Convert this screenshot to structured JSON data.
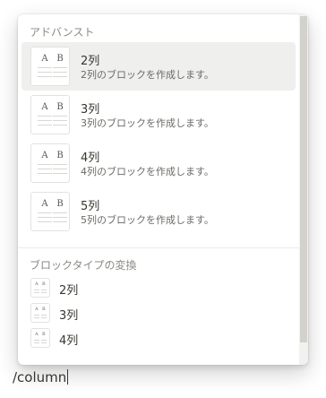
{
  "menu": {
    "section1_label": "アドバンスト",
    "items": [
      {
        "title": "2列",
        "desc": "2列のブロックを作成します。",
        "selected": true,
        "icon": "columns-preview-icon"
      },
      {
        "title": "3列",
        "desc": "3列のブロックを作成します。",
        "selected": false,
        "icon": "columns-preview-icon"
      },
      {
        "title": "4列",
        "desc": "4列のブロックを作成します。",
        "selected": false,
        "icon": "columns-preview-icon"
      },
      {
        "title": "5列",
        "desc": "5列のブロックを作成します。",
        "selected": false,
        "icon": "columns-preview-icon"
      }
    ],
    "section2_label": "ブロックタイプの変換",
    "turn_into_items": [
      {
        "label": "2列",
        "icon": "columns-preview-icon"
      },
      {
        "label": "3列",
        "icon": "columns-preview-icon"
      },
      {
        "label": "4列",
        "icon": "columns-preview-icon"
      }
    ],
    "thumb_glyphs": {
      "left": "A",
      "right": "B"
    }
  },
  "editor": {
    "command_text": "/column"
  },
  "colors": {
    "selected_bg": "#efefed",
    "text": "#37352f",
    "muted": "#8a8984"
  }
}
